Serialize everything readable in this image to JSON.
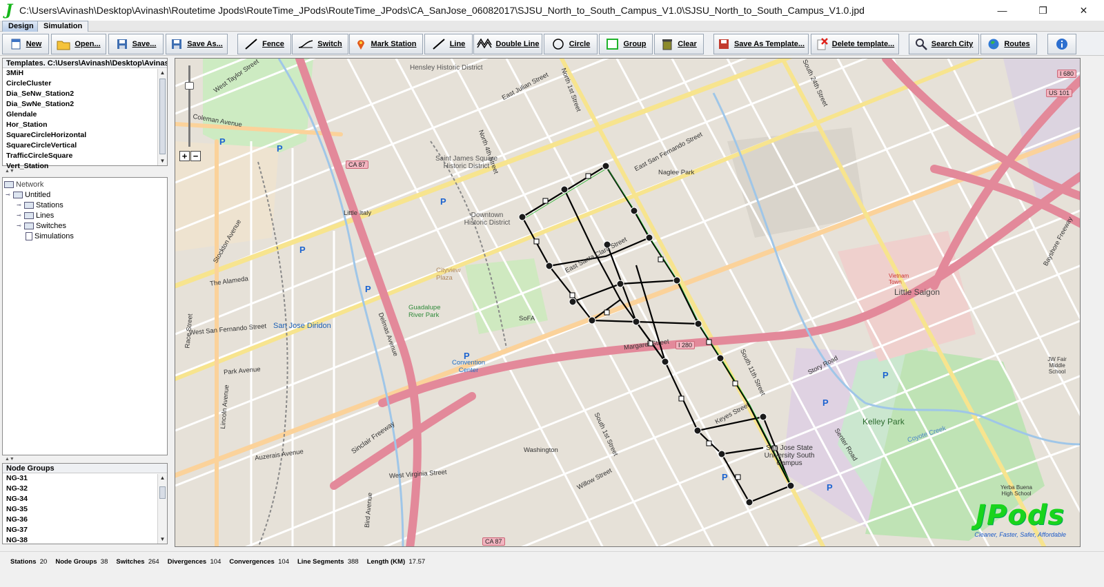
{
  "window": {
    "title": "C:\\Users\\Avinash\\Desktop\\Avinash\\Routetime Jpods\\RouteTime_JPods\\RouteTime_JPods\\CA_SanJose_06082017\\SJSU_North_to_South_Campus_V1.0\\SJSU_North_to_South_Campus_V1.0.jpd",
    "logo": "J"
  },
  "tabs": [
    {
      "label": "Design"
    },
    {
      "label": "Simulation"
    }
  ],
  "toolbar": {
    "new": "New",
    "open": "Open...",
    "save": "Save...",
    "save_as": "Save As...",
    "fence": "Fence",
    "switch": "Switch",
    "mark_station": "Mark Station",
    "line": "Line",
    "double_line": "Double Line",
    "circle": "Circle",
    "group": "Group",
    "clear": "Clear",
    "save_as_template": "Save As Template...",
    "delete_template": "Delete template...",
    "search_city": "Search City",
    "routes": "Routes"
  },
  "templates": {
    "header": "Templates. C:\\Users\\Avinash\\Desktop\\Avinash\\R...",
    "items": [
      "3MiH",
      "CircleCluster",
      "Dia_SeNw_Station2",
      "Dia_SwNe_Station2",
      "Glendale",
      "Hor_Station",
      "SquareCircleHorizontal",
      "SquareCircleVertical",
      "TrafficCircleSquare",
      "Vert_Station"
    ]
  },
  "tree": {
    "root": "Network",
    "project": "Untitled",
    "children": [
      "Stations",
      "Lines",
      "Switches",
      "Simulations"
    ]
  },
  "node_groups": {
    "header": "Node Groups",
    "items": [
      "NG-31",
      "NG-32",
      "NG-34",
      "NG-35",
      "NG-36",
      "NG-37",
      "NG-38"
    ]
  },
  "map": {
    "streets": [
      "West Taylor Street",
      "Coleman Avenue",
      "Stockton Avenue",
      "The Alameda",
      "West San Fernando Street",
      "Park Avenue",
      "Lincoln Avenue",
      "Race Street",
      "Auzerais Avenue",
      "West Virginia Street",
      "Bird Avenue",
      "Sinclair Freeway",
      "Delmas Avenue",
      "North 1st Street",
      "North 4th Street",
      "East Julian Street",
      "East San Fernando Street",
      "East Santa Clara Street",
      "Story Road",
      "Senter Road",
      "Keyes Street",
      "Willow Street",
      "South 1st Street",
      "South 11th Street",
      "South 24th Street",
      "Bayshore Freeway",
      "Margaret Street",
      "Washington",
      "Coyote Creek"
    ],
    "places": [
      "Hensley Historic District",
      "Saint James Square Historic District",
      "Downtown Historic District",
      "Little Italy",
      "Naglee Park",
      "Cityview Plaza",
      "Guadalupe River Park",
      "SoFA",
      "Convention Center",
      "San Jose Diridon",
      "Little Saigon",
      "Vietnam Town",
      "Kelley Park",
      "San Jose State University South Campus",
      "JW Fair Middle School",
      "Yerba Buena High School"
    ],
    "shields": [
      "CA 87",
      "I 280",
      "US 101",
      "I 680",
      "CA 87"
    ],
    "watermark": "JPods",
    "watermark_tag": "Cleaner, Faster, Safer, Affordable"
  },
  "status": {
    "stations_label": "Stations",
    "stations": "20",
    "node_groups_label": "Node Groups",
    "node_groups": "38",
    "switches_label": "Switches",
    "switches": "264",
    "divergences_label": "Divergences",
    "divergences": "104",
    "convergences_label": "Convergences",
    "convergences": "104",
    "line_segments_label": "Line Segments",
    "line_segments": "388",
    "length_label": "Length (KM)",
    "length": "17.57"
  }
}
